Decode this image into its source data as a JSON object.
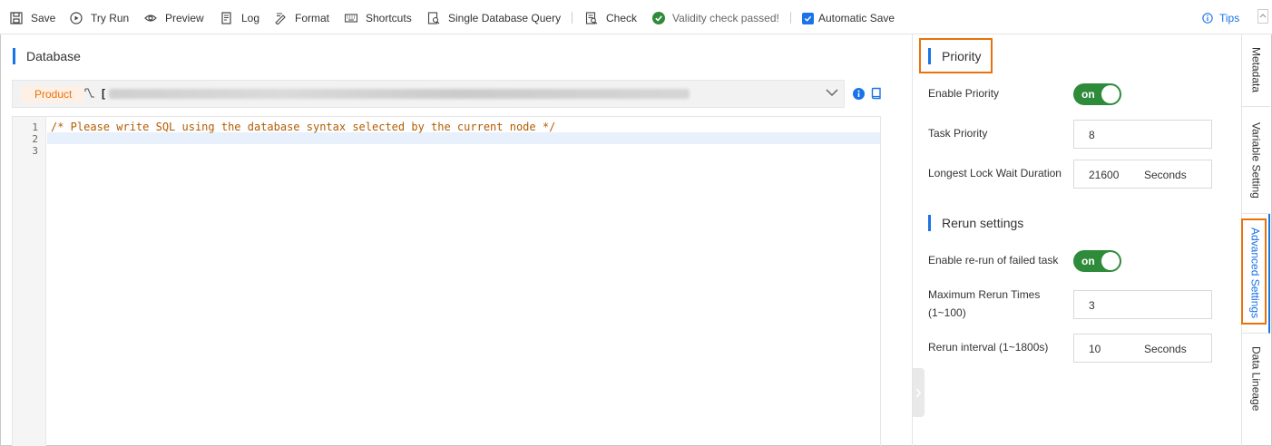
{
  "toolbar": {
    "save": "Save",
    "try_run": "Try Run",
    "preview": "Preview",
    "log": "Log",
    "format": "Format",
    "shortcuts": "Shortcuts",
    "single_db_query": "Single Database Query",
    "check": "Check",
    "validity": "Validity check passed!",
    "auto_save": "Automatic Save",
    "tips": "Tips"
  },
  "editor": {
    "section_title": "Database",
    "datasource_type": "Product",
    "datasource_value_prefix": "[",
    "line_numbers": [
      "1",
      "2",
      "3"
    ],
    "lines": [
      "/* Please write SQL using the database syntax selected by the current node */",
      "",
      ""
    ]
  },
  "priority": {
    "title": "Priority",
    "enable_label": "Enable Priority",
    "enable_state": "on",
    "task_priority_label": "Task Priority",
    "task_priority_value": "8",
    "lock_wait_label": "Longest Lock Wait Duration",
    "lock_wait_value": "21600",
    "lock_wait_unit": "Seconds"
  },
  "rerun": {
    "title": "Rerun settings",
    "enable_label": "Enable re-run of failed task",
    "enable_state": "on",
    "max_times_label_1": "Maximum Rerun Times",
    "max_times_label_2": "(1~100)",
    "max_times_value": "3",
    "interval_label": "Rerun interval (1~1800s)",
    "interval_value": "10",
    "interval_unit": "Seconds"
  },
  "side_tabs": [
    "Metadata",
    "Variable Setting",
    "Advanced Settings",
    "Data Lineage"
  ],
  "colors": {
    "accent": "#1a73e8",
    "highlight": "#e8720c",
    "toggle_on": "#2e8b3a",
    "success": "#2e8b3a"
  }
}
